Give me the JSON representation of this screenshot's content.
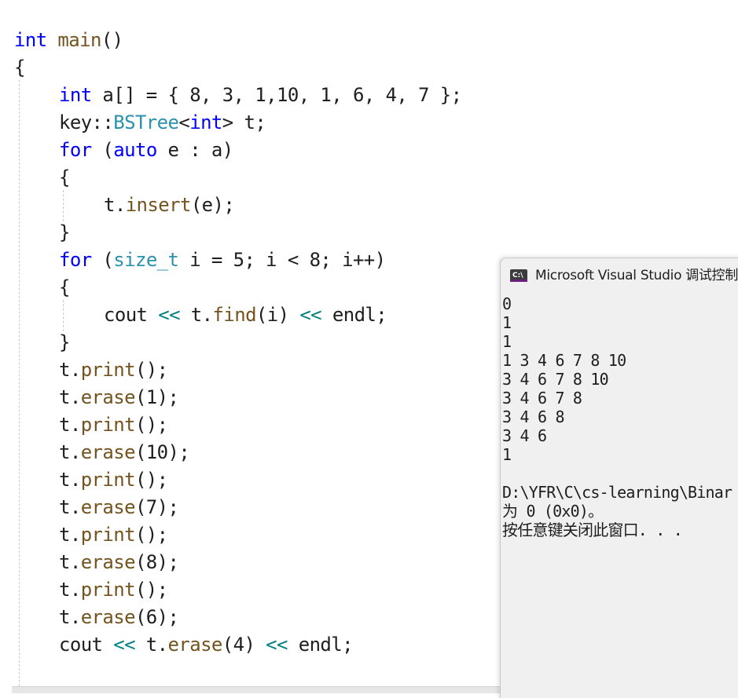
{
  "editor": {
    "lines": [
      {
        "tokens": [
          {
            "t": "int",
            "c": "kw"
          },
          {
            "t": " ",
            "c": "pl"
          },
          {
            "t": "main",
            "c": "fn"
          },
          {
            "t": "()",
            "c": "pl"
          }
        ]
      },
      {
        "tokens": [
          {
            "t": "{",
            "c": "pl"
          }
        ]
      },
      {
        "tokens": [
          {
            "t": "int",
            "c": "kw"
          },
          {
            "t": " a[] = { 8, 3, 1,10, 1, 6, 4, 7 };",
            "c": "pl"
          }
        ]
      },
      {
        "tokens": [
          {
            "t": "key::",
            "c": "pl"
          },
          {
            "t": "BSTree",
            "c": "ty"
          },
          {
            "t": "<",
            "c": "pl"
          },
          {
            "t": "int",
            "c": "kw"
          },
          {
            "t": "> t;",
            "c": "pl"
          }
        ]
      },
      {
        "tokens": [
          {
            "t": "for",
            "c": "kw"
          },
          {
            "t": " (",
            "c": "pl"
          },
          {
            "t": "auto",
            "c": "kw"
          },
          {
            "t": " e : a)",
            "c": "pl"
          }
        ]
      },
      {
        "tokens": [
          {
            "t": "{",
            "c": "pl"
          }
        ]
      },
      {
        "tokens": [
          {
            "t": "t.",
            "c": "pl"
          },
          {
            "t": "insert",
            "c": "fn"
          },
          {
            "t": "(e);",
            "c": "pl"
          }
        ]
      },
      {
        "tokens": [
          {
            "t": "}",
            "c": "pl"
          }
        ]
      },
      {
        "tokens": [
          {
            "t": "for",
            "c": "kw"
          },
          {
            "t": " (",
            "c": "pl"
          },
          {
            "t": "size_t",
            "c": "ty"
          },
          {
            "t": " i = 5; i < 8; i++)",
            "c": "pl"
          }
        ]
      },
      {
        "tokens": [
          {
            "t": "{",
            "c": "pl"
          }
        ]
      },
      {
        "tokens": [
          {
            "t": "cout ",
            "c": "pl"
          },
          {
            "t": "<<",
            "c": "op"
          },
          {
            "t": " t.",
            "c": "pl"
          },
          {
            "t": "find",
            "c": "fn"
          },
          {
            "t": "(i) ",
            "c": "pl"
          },
          {
            "t": "<<",
            "c": "op"
          },
          {
            "t": " endl;",
            "c": "pl"
          }
        ]
      },
      {
        "tokens": [
          {
            "t": "}",
            "c": "pl"
          }
        ]
      },
      {
        "tokens": [
          {
            "t": "t.",
            "c": "pl"
          },
          {
            "t": "print",
            "c": "fn"
          },
          {
            "t": "();",
            "c": "pl"
          }
        ]
      },
      {
        "tokens": [
          {
            "t": "t.",
            "c": "pl"
          },
          {
            "t": "erase",
            "c": "fn"
          },
          {
            "t": "(1);",
            "c": "pl"
          }
        ]
      },
      {
        "tokens": [
          {
            "t": "t.",
            "c": "pl"
          },
          {
            "t": "print",
            "c": "fn"
          },
          {
            "t": "();",
            "c": "pl"
          }
        ]
      },
      {
        "tokens": [
          {
            "t": "t.",
            "c": "pl"
          },
          {
            "t": "erase",
            "c": "fn"
          },
          {
            "t": "(10);",
            "c": "pl"
          }
        ]
      },
      {
        "tokens": [
          {
            "t": "t.",
            "c": "pl"
          },
          {
            "t": "print",
            "c": "fn"
          },
          {
            "t": "();",
            "c": "pl"
          }
        ]
      },
      {
        "tokens": [
          {
            "t": "t.",
            "c": "pl"
          },
          {
            "t": "erase",
            "c": "fn"
          },
          {
            "t": "(7);",
            "c": "pl"
          }
        ]
      },
      {
        "tokens": [
          {
            "t": "t.",
            "c": "pl"
          },
          {
            "t": "print",
            "c": "fn"
          },
          {
            "t": "();",
            "c": "pl"
          }
        ]
      },
      {
        "tokens": [
          {
            "t": "t.",
            "c": "pl"
          },
          {
            "t": "erase",
            "c": "fn"
          },
          {
            "t": "(8);",
            "c": "pl"
          }
        ]
      },
      {
        "tokens": [
          {
            "t": "t.",
            "c": "pl"
          },
          {
            "t": "print",
            "c": "fn"
          },
          {
            "t": "();",
            "c": "pl"
          }
        ]
      },
      {
        "tokens": [
          {
            "t": "t.",
            "c": "pl"
          },
          {
            "t": "erase",
            "c": "fn"
          },
          {
            "t": "(6);",
            "c": "pl"
          }
        ]
      },
      {
        "tokens": [
          {
            "t": "cout ",
            "c": "pl"
          },
          {
            "t": "<<",
            "c": "op"
          },
          {
            "t": " t.",
            "c": "pl"
          },
          {
            "t": "erase",
            "c": "fn"
          },
          {
            "t": "(4) ",
            "c": "pl"
          },
          {
            "t": "<<",
            "c": "op"
          },
          {
            "t": " endl;",
            "c": "pl"
          }
        ]
      }
    ]
  },
  "console": {
    "icon": "console-app-icon",
    "icon_label": "C:\\",
    "title": "Microsoft Visual Studio 调试控制",
    "output": [
      "0",
      "1",
      "1",
      "1 3 4 6 7 8 10",
      "3 4 6 7 8 10",
      "3 4 6 7 8",
      "3 4 6 8",
      "3 4 6",
      "1",
      "",
      "D:\\YFR\\C\\cs-learning\\Binar",
      "为 0 (0x0)。",
      "按任意键关闭此窗口. . ."
    ]
  },
  "colors": {
    "keyword": "#0000ff",
    "type": "#2b91af",
    "function": "#74531f",
    "operator": "#008080",
    "text": "#1e1e1e",
    "console_bg": "#f0f0f0"
  }
}
